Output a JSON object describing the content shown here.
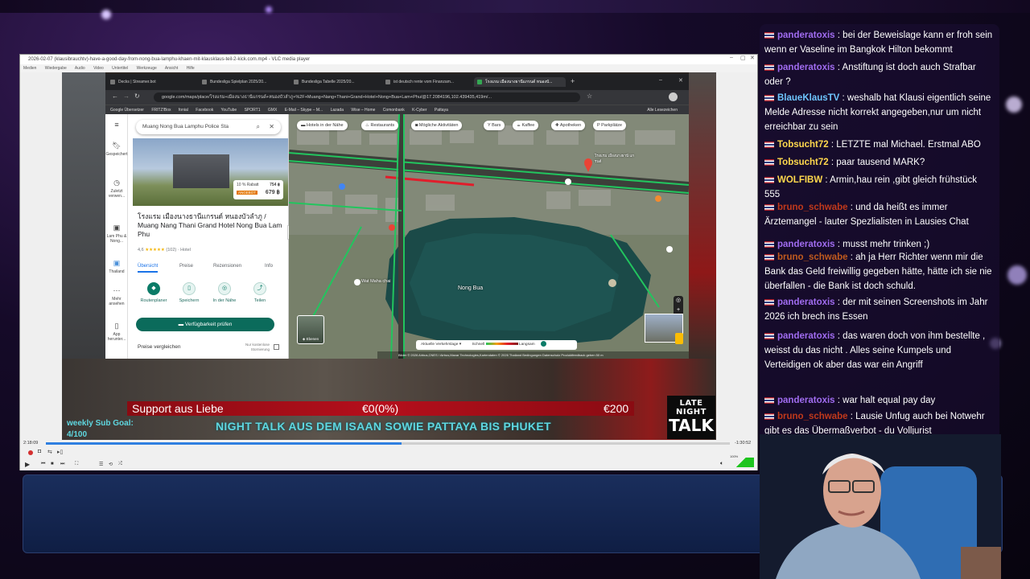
{
  "vlc": {
    "title": "2026-02-07 (klausibrauchtv)-have-a-good-day-from-nong-bua-lamphu-khaen-mit-klausklaus-teil-2-kick.com.mp4 - VLC media player",
    "menu": [
      "Medien",
      "Wiedergabe",
      "Audio",
      "Video",
      "Untertitel",
      "Werkzeuge",
      "Ansicht",
      "Hilfe"
    ],
    "time_elapsed": "2:18:09",
    "time_remaining": "-1:30:52",
    "volume": "100%",
    "progress": 0.52
  },
  "browser": {
    "tabs": [
      {
        "label": "Decks | Streamer.bot"
      },
      {
        "label": "Bundesliga Spielplan 2025/20..."
      },
      {
        "label": "Bundesliga Tabelle 2025/20..."
      },
      {
        "label": "ist deutsch rente vom Finanzam..."
      },
      {
        "label": "โรงแรม เมืองนางธานีแกรนด์ หนองบั...",
        "active": true
      }
    ],
    "url": "google.com/maps/place/โรงแรม+เมืองนางธานีแกรนด์+หนองบัวลำภู+%2F+Muang+Nang+Thani+Grand+Hotel+Nong+Bua+Lam+Phu/@17.2084196,102.439435,419m/...",
    "bookmarks": [
      "Google Übersetzer",
      "FRITZ!Box",
      "fonial",
      "Facebook",
      "YouTube",
      "SPORT1",
      "GMX",
      "E-Mail – Skype – M...",
      "Lazada",
      "Wise – Home",
      "Comonbank",
      "K-Cyber",
      "Pattaya"
    ],
    "bookmarks_all": "Alle Lesezeichen"
  },
  "maps": {
    "rail": [
      {
        "icon": "menu-icon",
        "label": ""
      },
      {
        "icon": "bookmark-icon",
        "label": "Gespeichert"
      },
      {
        "icon": "history-icon",
        "label": "Zuletzt verwen..."
      },
      {
        "icon": "place-icon",
        "label": "Lam Phu & Nong..."
      },
      {
        "icon": "place-icon",
        "label": "Thailand"
      },
      {
        "icon": "more-icon",
        "label": "Mehr ansehen"
      },
      {
        "icon": "phone-icon",
        "label": "App herunter..."
      }
    ],
    "search_value": "Muang Nong Bua Lamphu Police Sta",
    "discount": "10 % Rabatt",
    "old_price": "754 ฿",
    "offer_label": "ANGEBOT",
    "price": "679 ฿",
    "hotel_name": "โรงแรม เมืองนางธานีแกรนด์ หนองบัวลำภู / Muang Nang Thani Grand Hotel Nong Bua Lam Phu",
    "rating": "4,6",
    "stars": "★★★★★",
    "reviews": "(102)",
    "category": "· Hotel",
    "tabs": [
      "Übersicht",
      "Preise",
      "Rezensionen",
      "Info"
    ],
    "actions": [
      "Routenplaner",
      "Speichern",
      "In der Nähe",
      "Teilen"
    ],
    "availability_button": "Verfügbarkeit prüfen",
    "compare_prices": "Preise vergleichen",
    "free_cancel": "Nur kostenlose Stornierung",
    "chips": [
      "Hotels in der Nähe",
      "Restaurants",
      "Mögliche Aktivitäten",
      "Bars",
      "Kaffee",
      "Apotheken",
      "Parkplätze"
    ],
    "map_labels": {
      "lake": "Nong Bua",
      "temple": "Wat Maha chai",
      "hotel_marker": "โรงแรม เมืองนางธานี แกรนด์"
    },
    "layers": "Ebenen",
    "traffic_label": "Aktuelle Verkehrslage",
    "traffic_fast": "Schnell",
    "traffic_slow": "Langsam",
    "footer": "Bilder © 2026 Airbus,CNES / Airbus,Maxar Technologies,Kartendaten © 2026   Thailand   Bedingungen   Datenschutz   Produktfeedback geben   50 m"
  },
  "overlay": {
    "support_label": "Support aus Liebe",
    "support_current": "€0(0%)",
    "support_target": "€200",
    "subgoal_label": "weekly Sub Goal:",
    "subgoal_value": "4/100",
    "ticker": "NIGHT TALK AUS DEM ISAAN SOWIE PATTAYA BIS PHUKET",
    "logo_line1": "LATE NIGHT",
    "logo_line2": "TALK"
  },
  "chat": [
    {
      "user": "panderatoxis",
      "color": "#a06cf0",
      "text": "bei der Beweislage kann er froh sein wenn er Vaseline im Bangkok Hilton bekommt"
    },
    {
      "user": "panderatoxis",
      "color": "#a06cf0",
      "text": "Anstiftung ist doch auch Strafbar oder ?"
    },
    {
      "user": "BlaueKlausTV",
      "color": "#6ec6ff",
      "text": "weshalb hat Klausi eigentlich seine Melde Adresse nicht korrekt angegeben,nur um nicht erreichbar zu sein"
    },
    {
      "user": "Tobsucht72",
      "color": "#ffd84d",
      "text": "LETZTE mal Michael. Erstmal ABO"
    },
    {
      "user": "Tobsucht72",
      "color": "#ffd84d",
      "text": "paar tausend MARK?"
    },
    {
      "user": "WOLFIBW",
      "color": "#ffd84d",
      "text": "Armin,hau rein ,gibt gleich frühstück 555"
    },
    {
      "user": "bruno_schwabe",
      "color": "#c0391b",
      "text": "und da heißt es immer Ärztemangel - lauter Spezlialisten in Lausies Chat"
    },
    {
      "user": "panderatoxis",
      "color": "#a06cf0",
      "text": "musst mehr trinken ;)"
    },
    {
      "user": "bruno_schwabe",
      "color": "#c05a1e",
      "text": "ah ja Herr Richter wenn mir die Bank das Geld freiwillig gegeben hätte, hätte ich sie nie überfallen - die Bank ist doch schuld."
    },
    {
      "user": "panderatoxis",
      "color": "#a06cf0",
      "text": "der mit seinen Screenshots im Jahr 2026 ich brech ins Essen"
    },
    {
      "user": "panderatoxis",
      "color": "#a06cf0",
      "text": "das waren doch von ihm bestellte , weisst du das nicht . Alles seine Kumpels und Verteidigen ok aber das war ein Angriff"
    },
    {
      "user": "panderatoxis",
      "color": "#a06cf0",
      "text": "war halt equal pay day"
    },
    {
      "user": "bruno_schwabe",
      "color": "#c0391b",
      "text": "Lausie Unfug auch bei Notwehr gibt es das Übermaßverbot - du Volljurist"
    }
  ]
}
